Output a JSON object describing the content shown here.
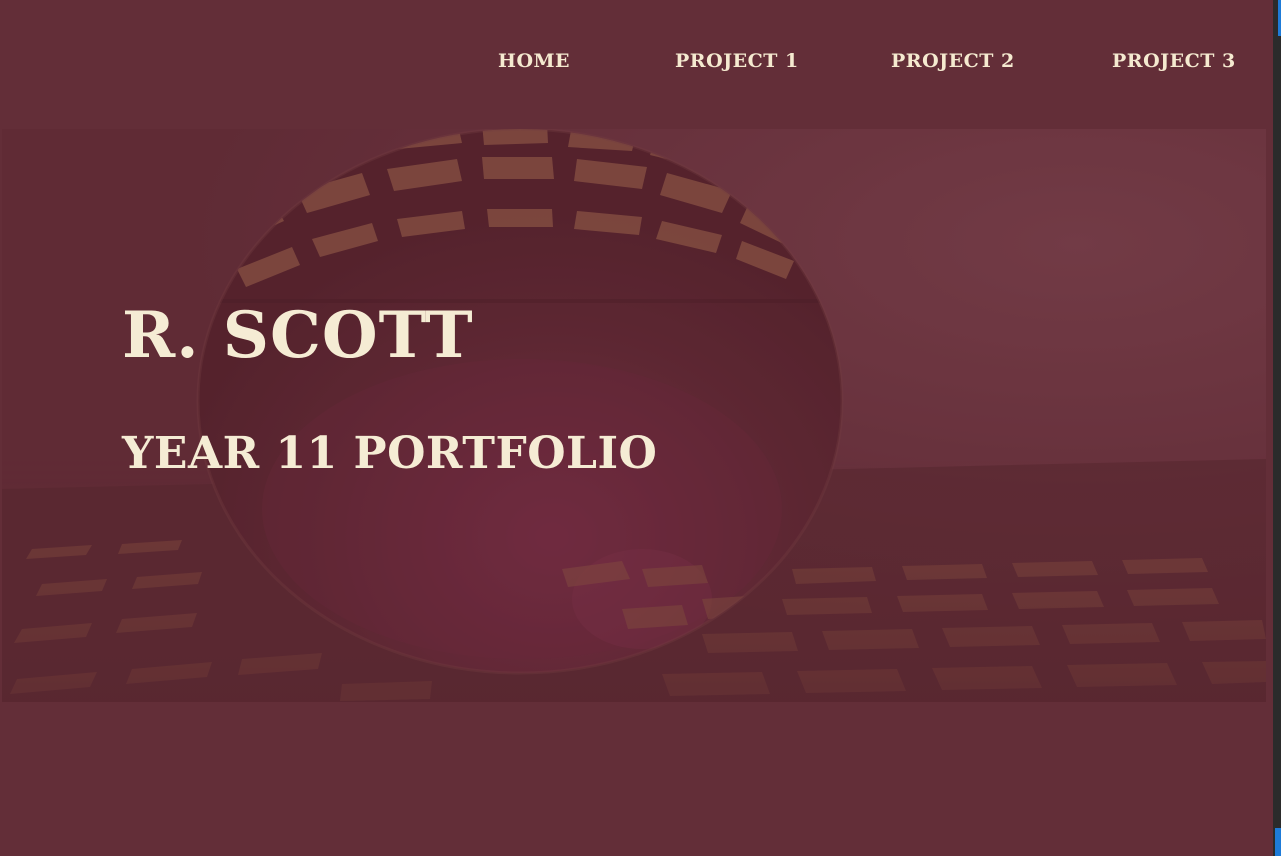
{
  "nav": {
    "items": [
      {
        "label": "HOME"
      },
      {
        "label": "PROJECT 1"
      },
      {
        "label": "PROJECT 2"
      },
      {
        "label": "PROJECT 3"
      }
    ]
  },
  "hero": {
    "title": "R. SCOTT",
    "subtitle": "YEAR 11 PORTFOLIO",
    "image": "crystal-ball-on-grid-photo"
  },
  "colors": {
    "background": "#632e38",
    "text": "#f5ecd4",
    "scrollbar_accent": "#1e7bd8"
  }
}
